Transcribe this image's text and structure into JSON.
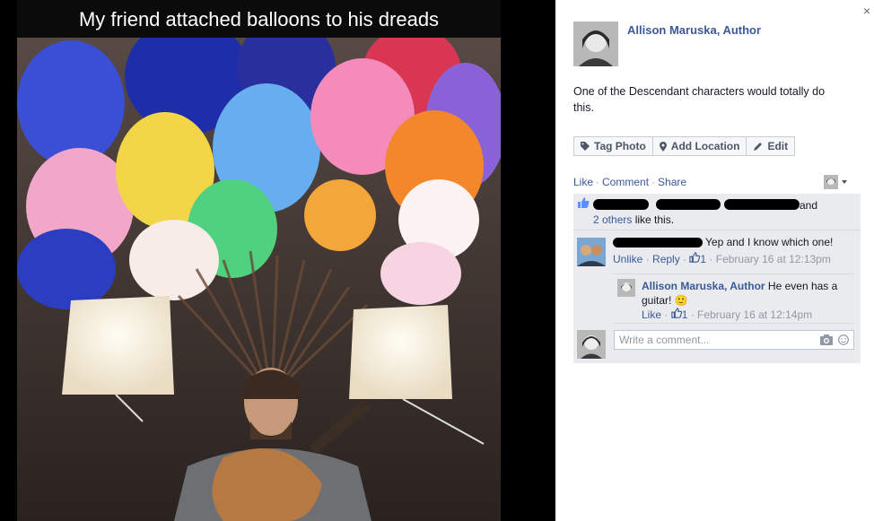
{
  "photo": {
    "caption": "My friend attached balloons to his dreads",
    "balloon_colors": [
      "#3b4fd6",
      "#1f2fb0",
      "#f0d34a",
      "#5ea8ee",
      "#f47fb0",
      "#f38a2e",
      "#7b58d8",
      "#f9f4f2",
      "#4fd07e",
      "#e94058",
      "#f4a3c5"
    ]
  },
  "panel": {
    "close_label": "×",
    "author": "Allison Maruska, Author",
    "post_text": "One of the Descendant characters would totally do this.",
    "actions": [
      {
        "label": "Tag Photo",
        "icon": "tag-icon"
      },
      {
        "label": "Add Location",
        "icon": "location-pin-icon"
      },
      {
        "label": "Edit",
        "icon": "pencil-icon"
      }
    ],
    "ufi_links": {
      "like": "Like",
      "comment": "Comment",
      "share": "Share",
      "sep": "·"
    },
    "likes": {
      "and_text": "and",
      "others_link": "2 others",
      "like_this": "like this."
    },
    "comment1": {
      "text": "Yep and I know which one!",
      "unlike": "Unlike",
      "reply": "Reply",
      "like_count": "1",
      "timestamp": "February 16 at 12:13pm"
    },
    "reply1": {
      "author": "Allison Maruska, Author",
      "text_line1": "He even has a",
      "text_line2": "guitar!",
      "emoji": "🙂",
      "like": "Like",
      "like_count": "1",
      "timestamp": "February 16 at 12:14pm"
    },
    "write_comment": {
      "placeholder": "Write a comment..."
    }
  }
}
